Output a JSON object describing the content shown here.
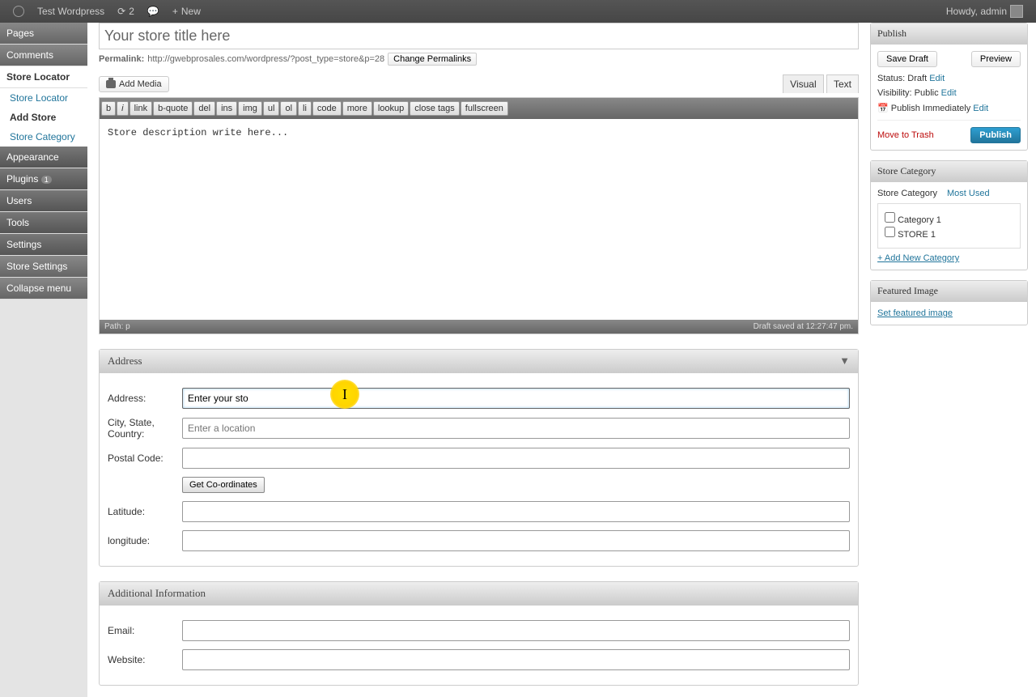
{
  "adminbar": {
    "site": "Test Wordpress",
    "updates": "2",
    "new": "New",
    "howdy": "Howdy, admin"
  },
  "sidebar": {
    "pages": "Pages",
    "comments": "Comments",
    "store_locator": "Store Locator",
    "sub_locator": "Store Locator",
    "sub_add": "Add Store",
    "sub_cat": "Store Category",
    "appearance": "Appearance",
    "plugins": "Plugins",
    "users": "Users",
    "tools": "Tools",
    "settings": "Settings",
    "store_settings": "Store Settings",
    "collapse": "Collapse menu"
  },
  "editor": {
    "title_value": "Your store title here",
    "permalink_label": "Permalink:",
    "permalink_url": "http://gwebprosales.com/wordpress/?post_type=store&p=28",
    "change_permalinks": "Change Permalinks",
    "add_media": "Add Media",
    "tab_visual": "Visual",
    "tab_text": "Text",
    "toolbar": [
      "b",
      "i",
      "link",
      "b-quote",
      "del",
      "ins",
      "img",
      "ul",
      "ol",
      "li",
      "code",
      "more",
      "lookup",
      "close tags",
      "fullscreen"
    ],
    "content": "Store description write here...",
    "status_left": "Path: p",
    "status_right": "Draft saved at 12:27:47 pm."
  },
  "address": {
    "heading": "Address",
    "l_address": "Address:",
    "v_address": "Enter your sto",
    "l_city": "City, State, Country:",
    "p_city": "Enter a location",
    "l_postal": "Postal Code:",
    "btn_coords": "Get Co-ordinates",
    "l_lat": "Latitude:",
    "l_lng": "longitude:"
  },
  "additional": {
    "heading": "Additional Information",
    "l_email": "Email:",
    "l_website": "Website:"
  },
  "publish": {
    "heading": "Publish",
    "save_draft": "Save Draft",
    "preview": "Preview",
    "status": "Status: Draft",
    "visibility": "Visibility: Public",
    "publish_when": "Publish Immediately",
    "edit": "Edit",
    "trash": "Move to Trash",
    "publish_btn": "Publish"
  },
  "category": {
    "heading": "Store Category",
    "tab1": "Store Category",
    "tab2": "Most Used",
    "items": [
      "Category 1",
      "STORE 1"
    ],
    "add_new": "+ Add New Category"
  },
  "featured": {
    "heading": "Featured Image",
    "set": "Set featured image"
  }
}
